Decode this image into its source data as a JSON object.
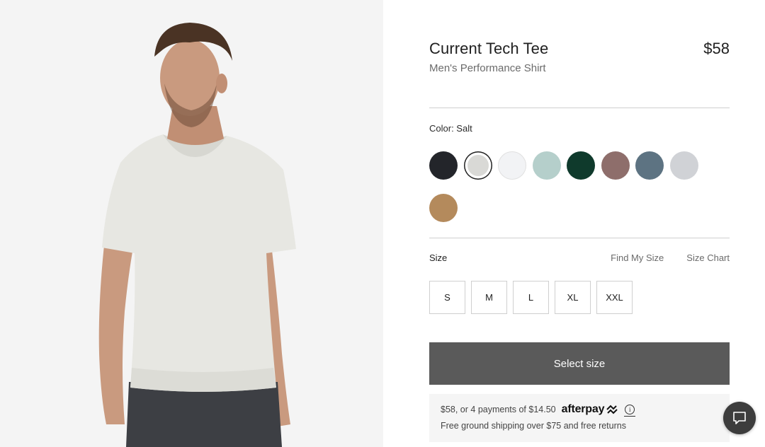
{
  "product": {
    "title": "Current Tech Tee",
    "price": "$58",
    "subtitle": "Men's Performance Shirt"
  },
  "color": {
    "label": "Color: Salt",
    "selected_index": 1,
    "swatches": [
      {
        "name": "black",
        "hex": "#23252a"
      },
      {
        "name": "salt",
        "hex": "#d9d9d6"
      },
      {
        "name": "white",
        "hex": "#f2f3f5"
      },
      {
        "name": "sage",
        "hex": "#b5cfcb"
      },
      {
        "name": "dark-green",
        "hex": "#0f3a2c"
      },
      {
        "name": "mauve",
        "hex": "#8e6e6b"
      },
      {
        "name": "slate-blue",
        "hex": "#5d7382"
      },
      {
        "name": "light-grey",
        "hex": "#d0d2d6"
      },
      {
        "name": "camel",
        "hex": "#b48a5c"
      }
    ]
  },
  "size": {
    "label": "Size",
    "find_my_size": "Find My Size",
    "size_chart": "Size Chart",
    "options": [
      "S",
      "M",
      "L",
      "XL",
      "XXL"
    ]
  },
  "cta": {
    "label": "Select size",
    "bg": "#5a5a5a"
  },
  "promo": {
    "installments": "$58, or 4 payments of $14.50",
    "afterpay_brand": "afterpay",
    "shipping": "Free ground shipping over $75 and free returns"
  },
  "icons": {
    "info": "info-icon",
    "chat": "chat-bubble-icon",
    "afterpay_arrows": "afterpay-logo-icon"
  }
}
